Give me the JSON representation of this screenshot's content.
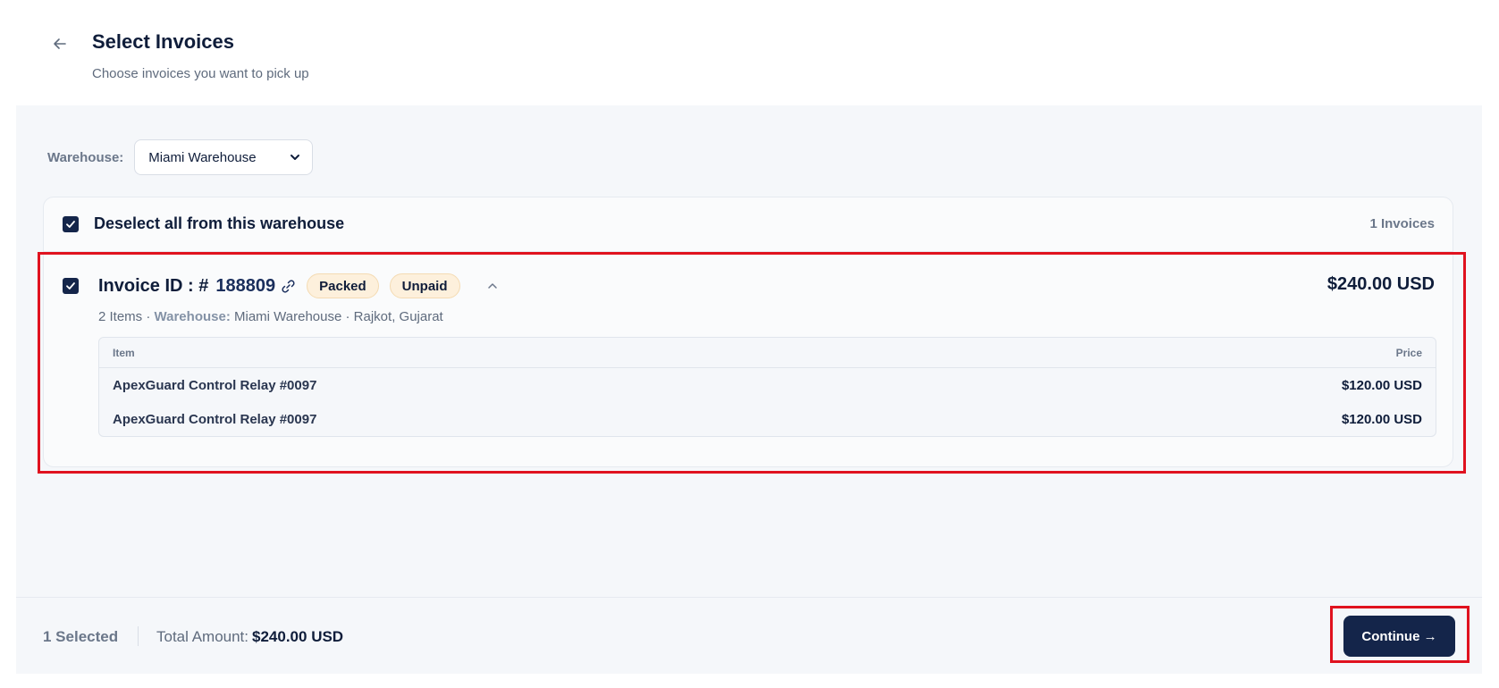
{
  "header": {
    "title": "Select Invoices",
    "subtitle": "Choose invoices you want to pick up"
  },
  "warehouse": {
    "label": "Warehouse:",
    "selected": "Miami Warehouse"
  },
  "card": {
    "deselect_label": "Deselect all from this warehouse",
    "count_label": "1 Invoices",
    "invoice": {
      "id_label": "Invoice ID : #",
      "id_number": "188809",
      "badges": [
        "Packed",
        "Unpaid"
      ],
      "total": "$240.00 USD",
      "items_count": "2 Items",
      "sep1": "·",
      "warehouse_label": "Warehouse:",
      "warehouse_value": "Miami Warehouse",
      "sep2": "·",
      "location": "Rajkot, Gujarat",
      "table": {
        "headers": [
          "Item",
          "Price"
        ],
        "rows": [
          {
            "name": "ApexGuard Control Relay #0097",
            "price": "$120.00 USD"
          },
          {
            "name": "ApexGuard Control Relay #0097",
            "price": "$120.00 USD"
          }
        ]
      }
    }
  },
  "footer": {
    "selected": "1 Selected",
    "total_label": "Total Amount:",
    "total_value": "$240.00 USD",
    "continue_label": "Continue →"
  },
  "colors": {
    "primary": "#14254a",
    "badge_bg": "#fdf0dc",
    "highlight": "#e0121f"
  }
}
